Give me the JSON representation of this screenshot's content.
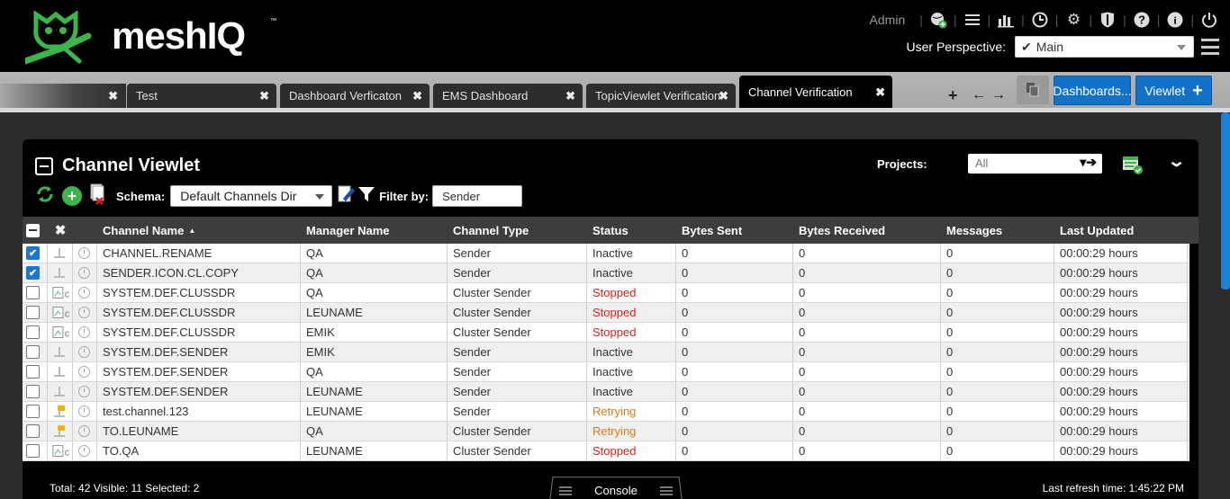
{
  "header": {
    "brand": "meshIQ",
    "brand_tm": "™",
    "user": "Admin",
    "icons": [
      "globe-add-icon",
      "list-icon",
      "bar-chart-icon",
      "clock-icon",
      "gear-icon",
      "shield-icon",
      "help-icon",
      "info-icon",
      "power-icon"
    ],
    "perspective_label": "User Perspective:",
    "perspective_value": "Main"
  },
  "tabs": [
    {
      "label": ""
    },
    {
      "label": "Test"
    },
    {
      "label": "Dashboard Verficaton"
    },
    {
      "label": "EMS Dashboard"
    },
    {
      "label": "TopicViewlet Verification"
    },
    {
      "label": "Channel Verification"
    }
  ],
  "tab_actions": {
    "dashboards_label": "Dashboards...",
    "viewlet_label": "Viewlet"
  },
  "viewlet": {
    "title": "Channel Viewlet",
    "projects_label": "Projects:",
    "projects_value": "All",
    "schema_label": "Schema:",
    "schema_value": "Default Channels Dir",
    "filter_label": "Filter by:",
    "filter_value": "Sender"
  },
  "columns": [
    "Channel Name",
    "Manager Name",
    "Channel Type",
    "Status",
    "Bytes Sent",
    "Bytes Received",
    "Messages",
    "Last Updated"
  ],
  "sort_indicator": "▲",
  "rows": [
    {
      "checked": true,
      "type_icon": "sender",
      "name": "CHANNEL.RENAME",
      "manager": "QA",
      "ctype": "Sender",
      "status": "Inactive",
      "sent": "0",
      "recv": "0",
      "msgs": "0",
      "updated": "00:00:29 hours"
    },
    {
      "checked": true,
      "type_icon": "sender",
      "name": "SENDER.ICON.CL.COPY",
      "manager": "QA",
      "ctype": "Sender",
      "status": "Inactive",
      "sent": "0",
      "recv": "0",
      "msgs": "0",
      "updated": "00:00:29 hours"
    },
    {
      "checked": false,
      "type_icon": "broken",
      "name": "SYSTEM.DEF.CLUSSDR",
      "manager": "QA",
      "ctype": "Cluster Sender",
      "status": "Stopped",
      "sent": "0",
      "recv": "0",
      "msgs": "0",
      "updated": "00:00:29 hours"
    },
    {
      "checked": false,
      "type_icon": "broken",
      "name": "SYSTEM.DEF.CLUSSDR",
      "manager": "LEUNAME",
      "ctype": "Cluster Sender",
      "status": "Stopped",
      "sent": "0",
      "recv": "0",
      "msgs": "0",
      "updated": "00:00:29 hours"
    },
    {
      "checked": false,
      "type_icon": "broken",
      "name": "SYSTEM.DEF.CLUSSDR",
      "manager": "EMIK",
      "ctype": "Cluster Sender",
      "status": "Stopped",
      "sent": "0",
      "recv": "0",
      "msgs": "0",
      "updated": "00:00:29 hours"
    },
    {
      "checked": false,
      "type_icon": "sender",
      "name": "SYSTEM.DEF.SENDER",
      "manager": "EMIK",
      "ctype": "Sender",
      "status": "Inactive",
      "sent": "0",
      "recv": "0",
      "msgs": "0",
      "updated": "00:00:29 hours"
    },
    {
      "checked": false,
      "type_icon": "sender",
      "name": "SYSTEM.DEF.SENDER",
      "manager": "QA",
      "ctype": "Sender",
      "status": "Inactive",
      "sent": "0",
      "recv": "0",
      "msgs": "0",
      "updated": "00:00:29 hours"
    },
    {
      "checked": false,
      "type_icon": "sender",
      "name": "SYSTEM.DEF.SENDER",
      "manager": "LEUNAME",
      "ctype": "Sender",
      "status": "Inactive",
      "sent": "0",
      "recv": "0",
      "msgs": "0",
      "updated": "00:00:29 hours"
    },
    {
      "checked": false,
      "type_icon": "retrying",
      "name": "test.channel.123",
      "manager": "LEUNAME",
      "ctype": "Sender",
      "status": "Retrying",
      "sent": "0",
      "recv": "0",
      "msgs": "0",
      "updated": "00:00:29 hours"
    },
    {
      "checked": false,
      "type_icon": "retrying",
      "name": "TO.LEUNAME",
      "manager": "QA",
      "ctype": "Cluster Sender",
      "status": "Retrying",
      "sent": "0",
      "recv": "0",
      "msgs": "0",
      "updated": "00:00:29 hours"
    },
    {
      "checked": false,
      "type_icon": "broken",
      "name": "TO.QA",
      "manager": "LEUNAME",
      "ctype": "Cluster Sender",
      "status": "Stopped",
      "sent": "0",
      "recv": "0",
      "msgs": "0",
      "updated": "00:00:29 hours"
    }
  ],
  "footer": {
    "summary": "Total: 42 Visible: 11 Selected: 2",
    "console_label": "Console",
    "refresh": "Last refresh time: 1:45:22 PM"
  },
  "colors": {
    "accent": "#1172c8",
    "brand_green": "#3db54a",
    "stopped": "#e0201a",
    "retrying": "#e0791a"
  }
}
